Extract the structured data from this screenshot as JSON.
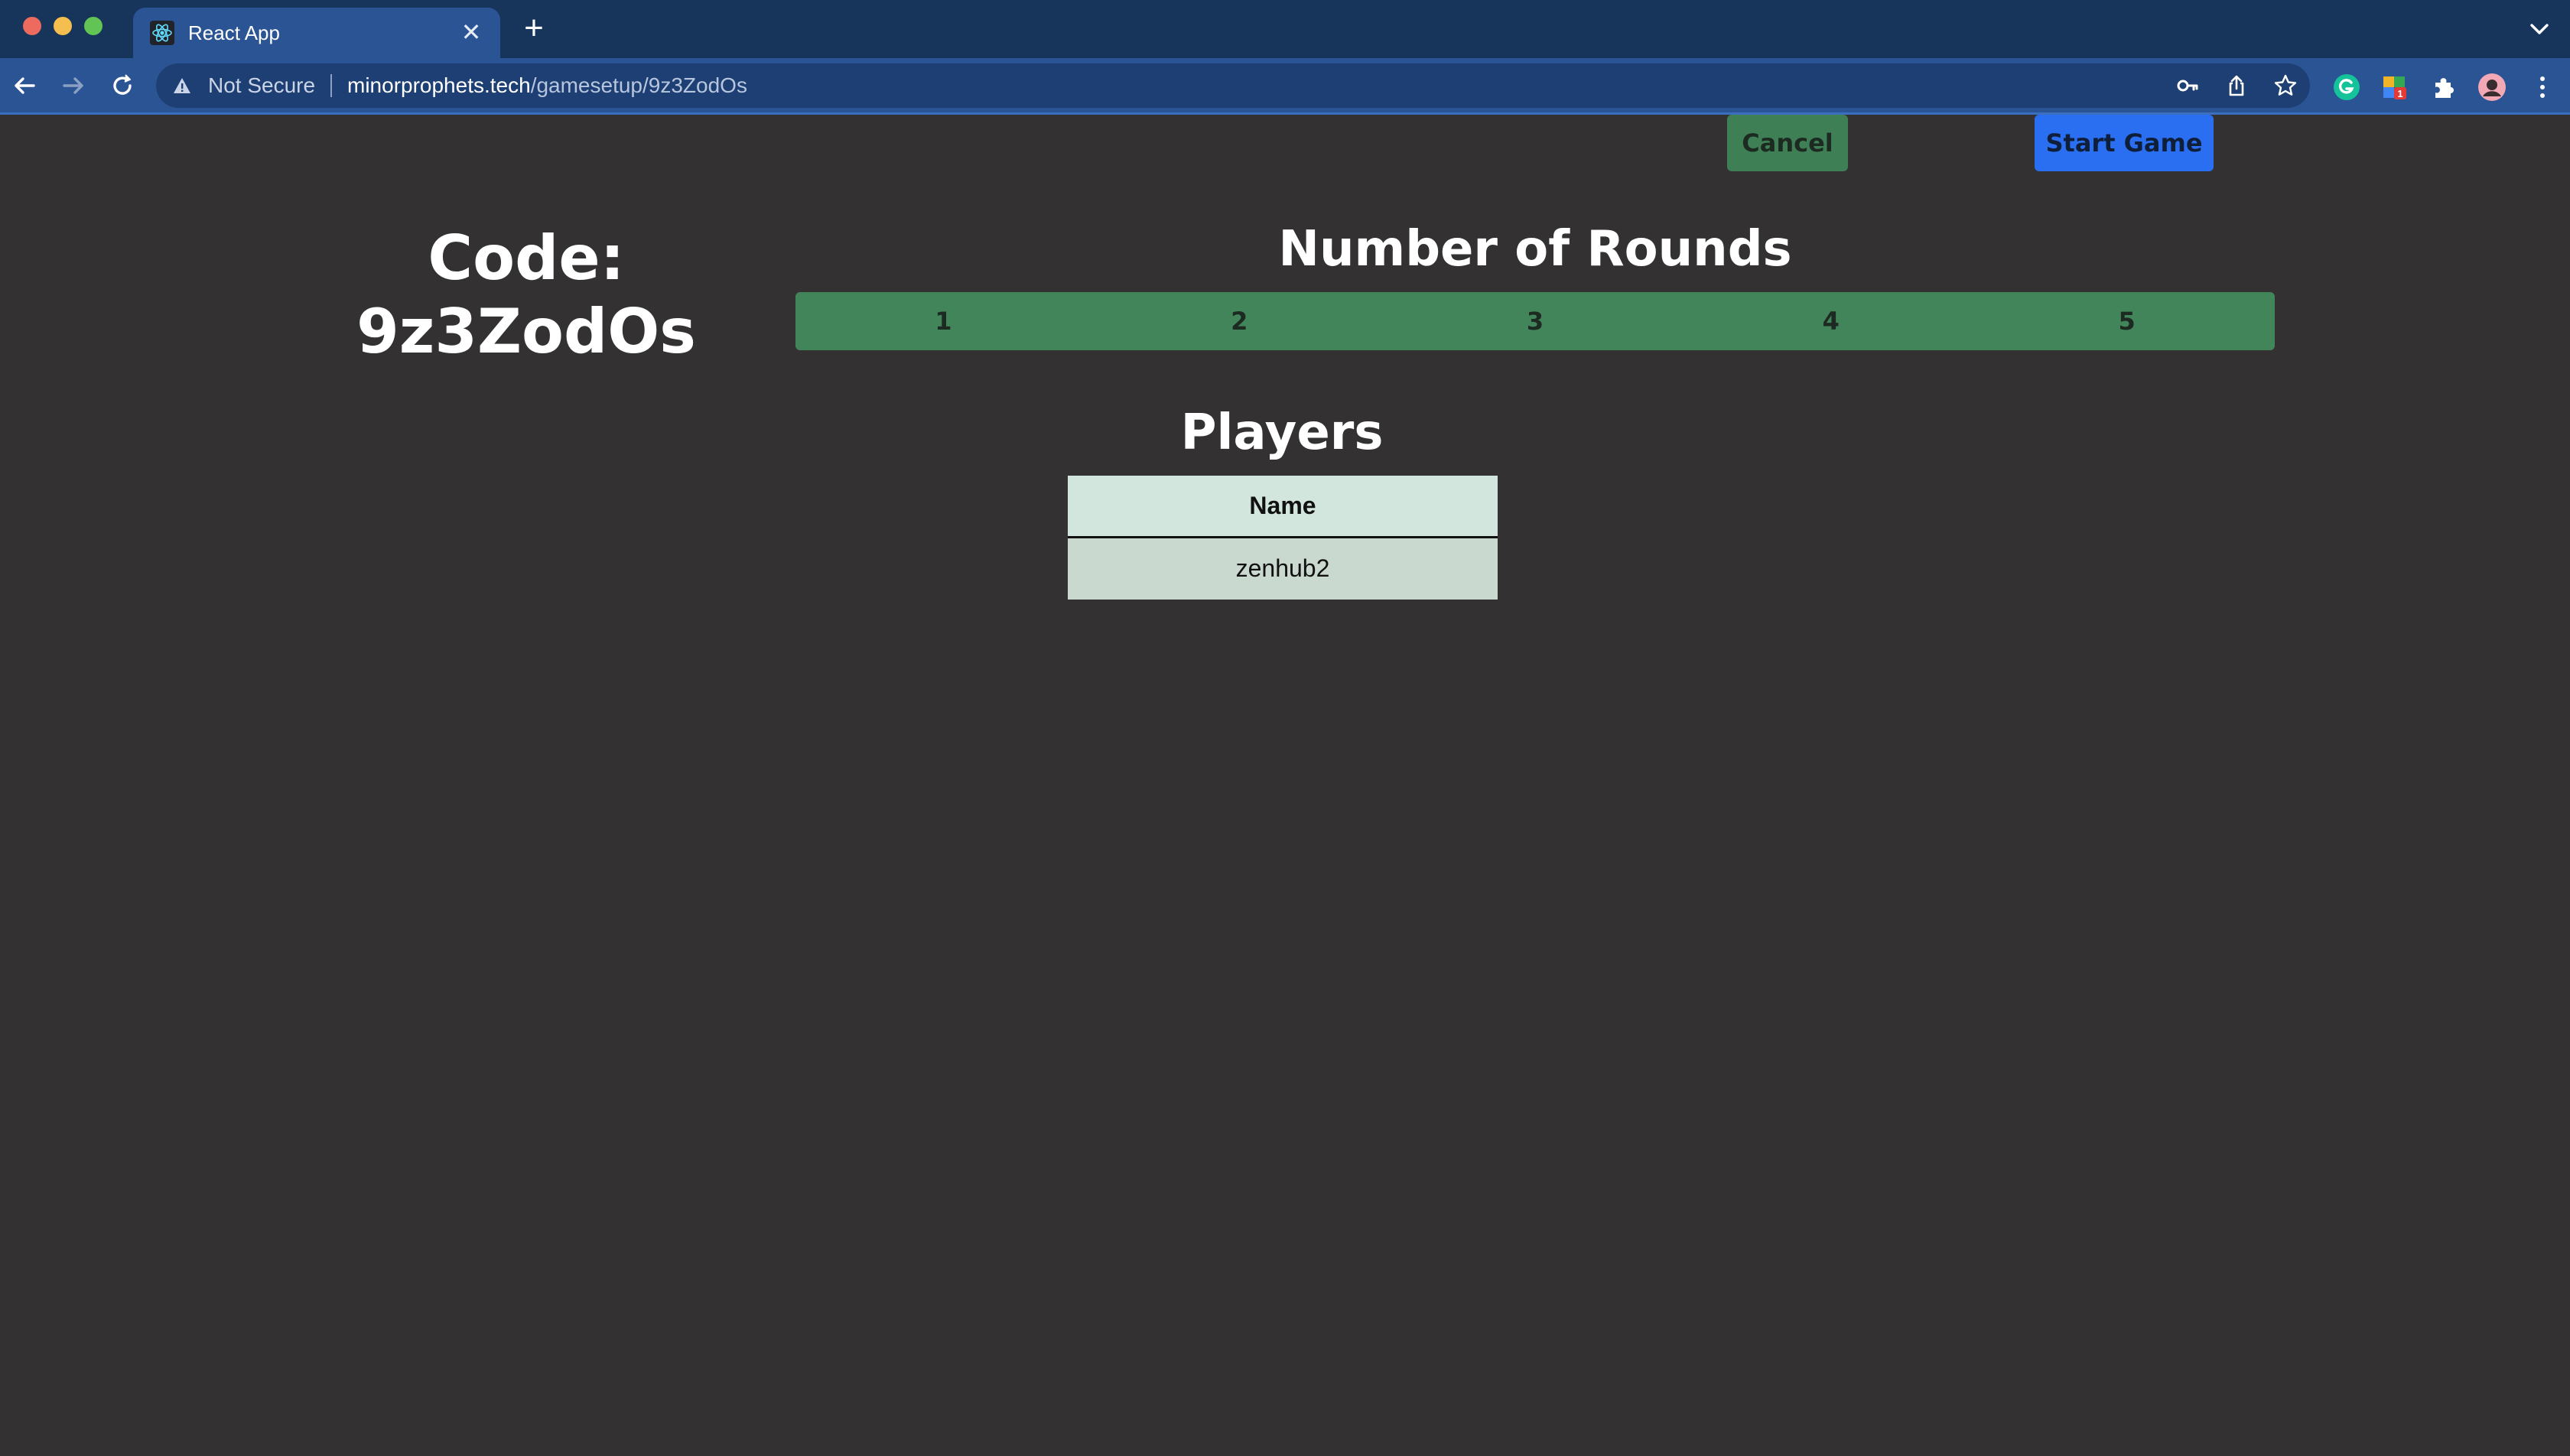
{
  "browser": {
    "tab_title": "React App",
    "tab_close": "✕",
    "new_tab": "+",
    "security_label": "Not Secure",
    "url_host": "minorprophets.tech",
    "url_path": "/gamesetup/9z3ZodOs",
    "extension_badge": "1"
  },
  "actions": {
    "cancel_label": "Cancel",
    "start_label": "Start Game"
  },
  "game": {
    "code_label": "Code:",
    "code_value": "9z3ZodOs"
  },
  "rounds": {
    "title": "Number of Rounds",
    "options": [
      "1",
      "2",
      "3",
      "4",
      "5"
    ]
  },
  "players": {
    "title": "Players",
    "column_header": "Name",
    "rows": [
      "zenhub2"
    ]
  },
  "colors": {
    "page_bg": "#333132",
    "accent_green": "#43855a",
    "start_blue": "#2a6ff2",
    "chrome_blue": "#2a5494"
  }
}
